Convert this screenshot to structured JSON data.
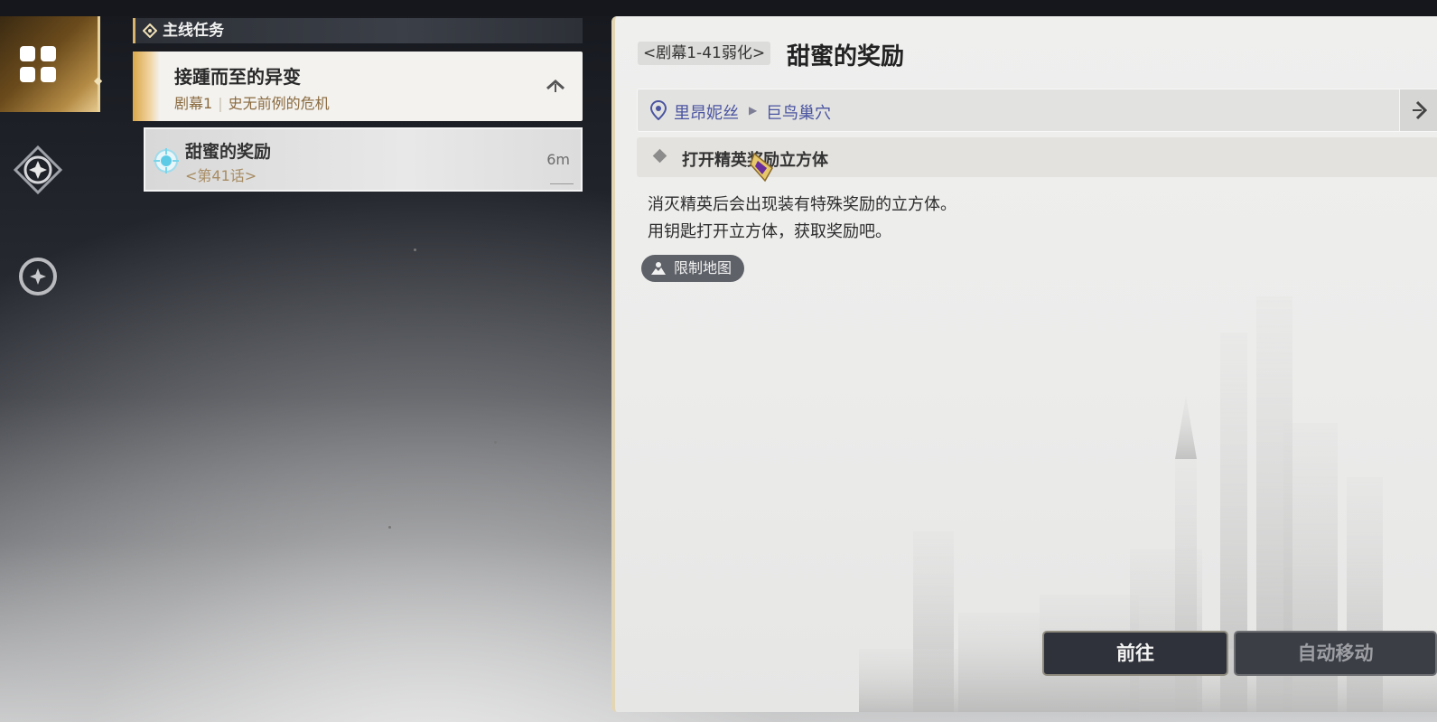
{
  "sidebar": {
    "items": [
      {
        "icon": "quest-grid-icon",
        "active": true
      },
      {
        "icon": "compass-star-icon",
        "active": false
      },
      {
        "icon": "circle-star-icon",
        "active": false
      }
    ]
  },
  "quest_list": {
    "section_title": "主线任务",
    "main_quest": {
      "title": "接踵而至的异变",
      "act": "剧幕1",
      "chapter_name": "史无前例的危机"
    },
    "sub_quest": {
      "title": "甜蜜的奖励",
      "chapter": "<第41话>",
      "distance": "6m"
    }
  },
  "detail": {
    "tag": "<剧幕1-41弱化>",
    "title": "甜蜜的奖励",
    "location": {
      "region": "里昂妮丝",
      "area": "巨鸟巢穴"
    },
    "objective": "打开精英奖励立方体",
    "description": [
      "消灭精英后会出现装有特殊奖励的立方体。",
      "用钥匙打开立方体，获取奖励吧。"
    ],
    "map_tag": "限制地图"
  },
  "buttons": {
    "go": "前往",
    "auto_move": "自动移动"
  },
  "colors": {
    "accent_gold": "#d8b46c",
    "location_text": "#4a54a0",
    "button_dark": "#2f323a"
  }
}
